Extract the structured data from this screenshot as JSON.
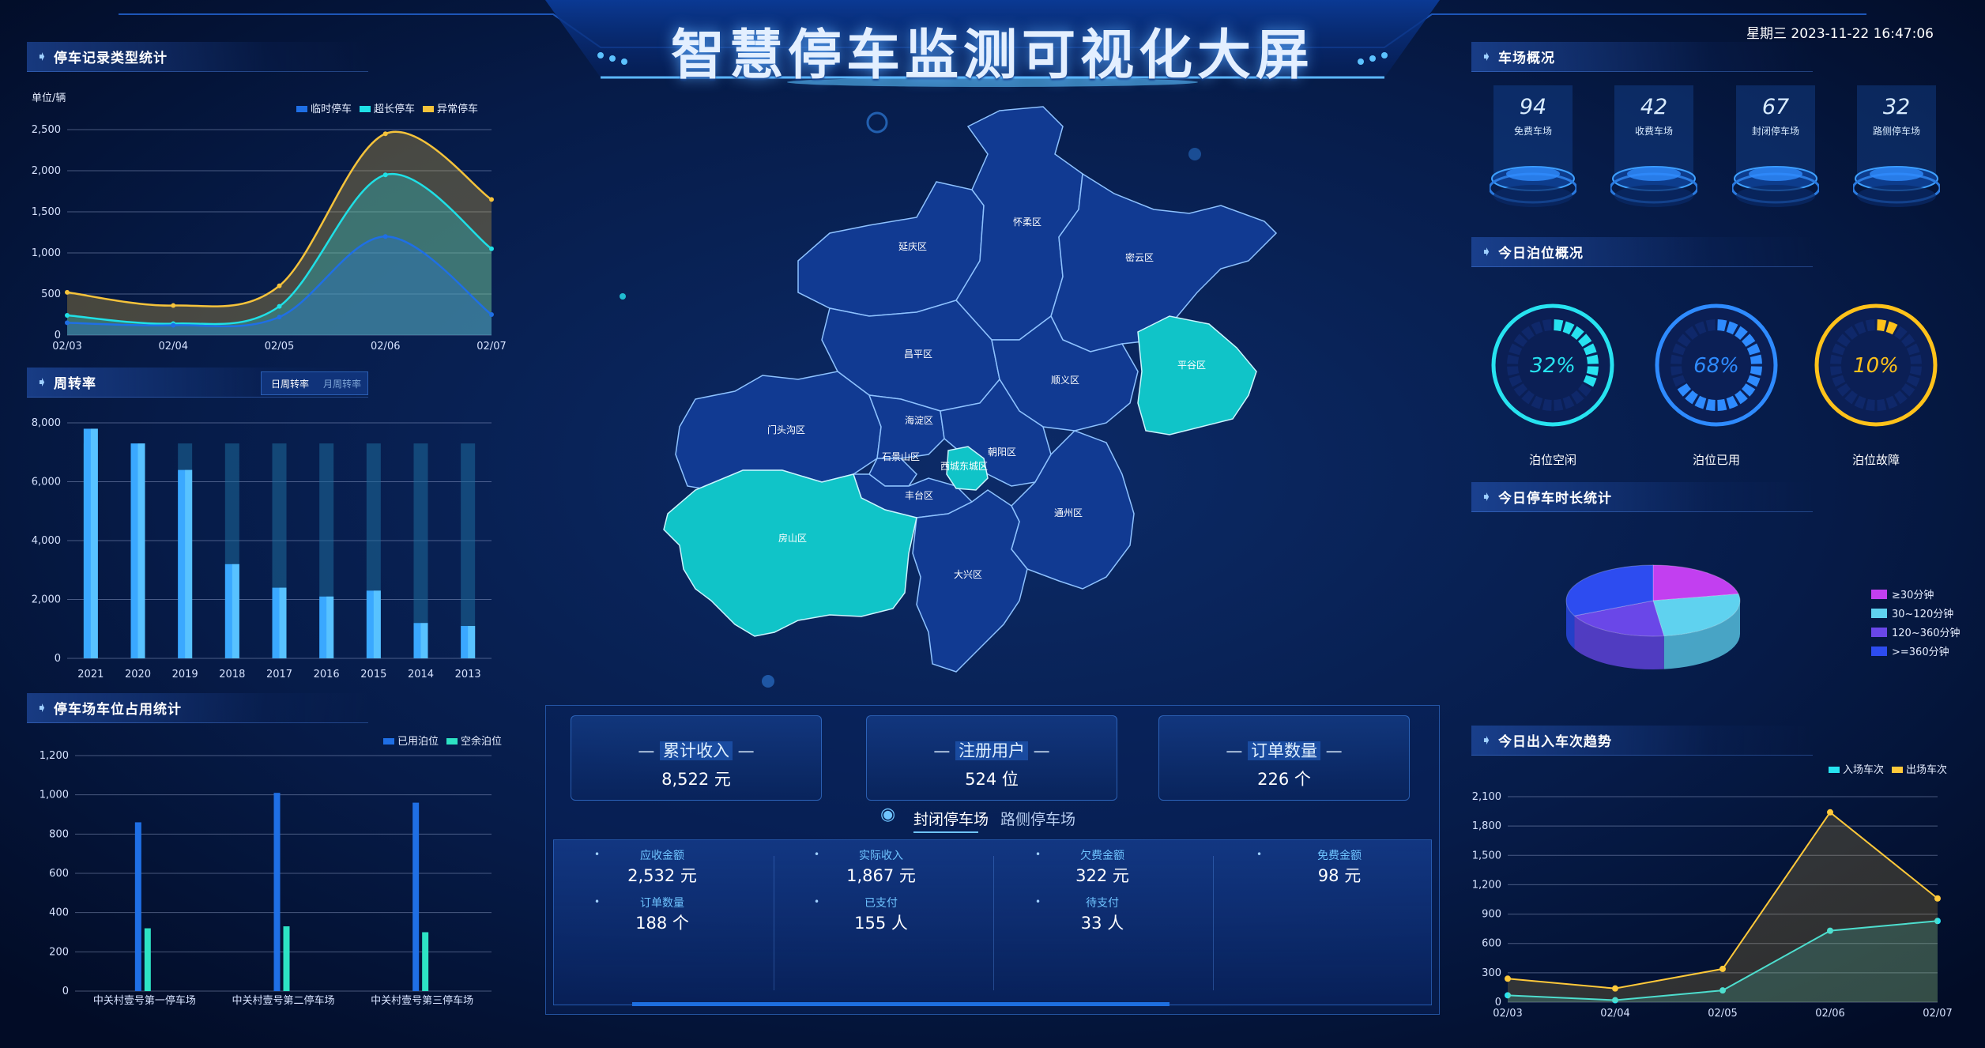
{
  "header": {
    "title": "智慧停车监测可视化大屏",
    "datetime": "星期三 2023-11-22 16:47:06"
  },
  "panels": {
    "parking_type": {
      "title": "停车记录类型统计"
    },
    "turnover": {
      "title": "周转率",
      "tabs": [
        "日周转率",
        "月周转率"
      ]
    },
    "occupancy": {
      "title": "停车场车位占用统计"
    },
    "overview": {
      "title": "车场概况"
    },
    "berth": {
      "title": "今日泊位概况"
    },
    "duration": {
      "title": "今日停车时长统计"
    },
    "inout": {
      "title": "今日出入车次趋势"
    }
  },
  "overview_items": [
    {
      "value": "94",
      "label": "免费车场"
    },
    {
      "value": "42",
      "label": "收费车场"
    },
    {
      "value": "67",
      "label": "封闭停车场"
    },
    {
      "value": "32",
      "label": "路侧停车场"
    }
  ],
  "gauges": [
    {
      "label": "泊位空闲",
      "percent": 32,
      "text": "32%",
      "color": "#27e3f0"
    },
    {
      "label": "泊位已用",
      "percent": 68,
      "text": "68%",
      "color": "#2e8bff"
    },
    {
      "label": "泊位故障",
      "percent": 10,
      "text": "10%",
      "color": "#ffc21a"
    }
  ],
  "map": {
    "districts": [
      "延庆区",
      "怀柔区",
      "密云区",
      "昌平区",
      "顺义区",
      "平谷区",
      "门头沟区",
      "海淀区",
      "石景山区",
      "朝阳区",
      "西城东城区",
      "丰台区",
      "房山区",
      "通州区",
      "大兴区"
    ]
  },
  "stats": {
    "boxes": [
      {
        "label": "累计收入",
        "value": "8,522 元"
      },
      {
        "label": "注册用户",
        "value": "524 位"
      },
      {
        "label": "订单数量",
        "value": "226 个"
      }
    ],
    "tabs": {
      "active": "封闭停车场",
      "other": "路侧停车场"
    },
    "grid": [
      {
        "label": "应收金额",
        "value": "2,532 元"
      },
      {
        "label": "实际收入",
        "value": "1,867 元"
      },
      {
        "label": "欠费金额",
        "value": "322 元"
      },
      {
        "label": "免费金额",
        "value": "98 元"
      },
      {
        "label": "订单数量",
        "value": "188 个"
      },
      {
        "label": "已支付",
        "value": "155 人"
      },
      {
        "label": "待支付",
        "value": "33 人"
      }
    ]
  },
  "chart_data": [
    {
      "id": "parking_type",
      "type": "area",
      "unit_label": "单位/辆",
      "x": [
        "02/03",
        "02/04",
        "02/05",
        "02/06",
        "02/07"
      ],
      "ylim": [
        0,
        2500
      ],
      "yticks": [
        "0",
        "500",
        "1,000",
        "1,500",
        "2,000",
        "2,500"
      ],
      "series": [
        {
          "name": "临时停车",
          "color": "#1f6fe5",
          "values": [
            150,
            120,
            220,
            1200,
            250
          ]
        },
        {
          "name": "超长停车",
          "color": "#1fe0e6",
          "values": [
            240,
            140,
            350,
            1950,
            1050
          ]
        },
        {
          "name": "异常停车",
          "color": "#f5c33b",
          "values": [
            520,
            360,
            600,
            2450,
            1650
          ]
        }
      ],
      "legend": "top-right",
      "grid": true
    },
    {
      "id": "turnover",
      "type": "bar",
      "categories": [
        "2021",
        "2020",
        "2019",
        "2018",
        "2017",
        "2016",
        "2015",
        "2014",
        "2013"
      ],
      "ylim": [
        0,
        8000
      ],
      "yticks": [
        "0",
        "2,000",
        "4,000",
        "6,000",
        "8,000"
      ],
      "values": [
        7800,
        7300,
        6400,
        3200,
        2400,
        2100,
        2300,
        1200,
        1100
      ],
      "background_value": 7300,
      "grid": true
    },
    {
      "id": "occupancy",
      "type": "bar",
      "categories": [
        "中关村壹号第一停车场",
        "中关村壹号第二停车场",
        "中关村壹号第三停车场"
      ],
      "ylim": [
        0,
        1200
      ],
      "yticks": [
        "0",
        "200",
        "400",
        "600",
        "800",
        "1,000",
        "1,200"
      ],
      "series": [
        {
          "name": "已用泊位",
          "color": "#1f6fe5",
          "values": [
            860,
            1010,
            960
          ]
        },
        {
          "name": "空余泊位",
          "color": "#2de3c4",
          "values": [
            320,
            330,
            300
          ]
        }
      ],
      "legend": "top-right",
      "grid": true
    },
    {
      "id": "duration",
      "type": "pie",
      "style": "3d",
      "slices": [
        {
          "name": "≥30分钟",
          "color": "#c23ff0",
          "value": 22
        },
        {
          "name": "30~120分钟",
          "color": "#5fd2ef",
          "value": 26
        },
        {
          "name": "120~360分钟",
          "color": "#6a47e8",
          "value": 20
        },
        {
          "name": ">=360分钟",
          "color": "#2d4cf0",
          "value": 32
        }
      ],
      "legend": "right"
    },
    {
      "id": "inout",
      "type": "line",
      "x": [
        "02/03",
        "02/04",
        "02/05",
        "02/06",
        "02/07"
      ],
      "ylim": [
        0,
        2100
      ],
      "yticks": [
        "0",
        "300",
        "600",
        "900",
        "1,200",
        "1,500",
        "1,800",
        "2,100"
      ],
      "series": [
        {
          "name": "入场车次",
          "color": "#27e3f0",
          "values": [
            70,
            20,
            120,
            730,
            830
          ]
        },
        {
          "name": "出场车次",
          "color": "#ffc93a",
          "values": [
            240,
            140,
            340,
            1940,
            1060
          ]
        }
      ],
      "legend": "top-right",
      "grid": true
    }
  ]
}
